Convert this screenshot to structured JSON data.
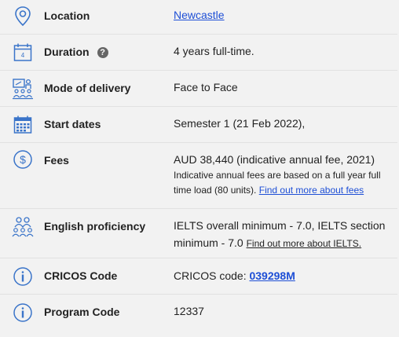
{
  "colors": {
    "icon": "#3a74c9",
    "link": "#1e4fd6",
    "background": "#f2f2f2",
    "divider": "#e1e1e1"
  },
  "rows": {
    "location": {
      "icon": "location-pin-icon",
      "label": "Location",
      "value_link": "Newcastle"
    },
    "duration": {
      "icon": "calendar-day-icon",
      "label": "Duration",
      "help_icon": "question-circle-icon",
      "calendar_day": "4",
      "value": "4 years full-time."
    },
    "delivery": {
      "icon": "classroom-icon",
      "label": "Mode of delivery",
      "value": "Face to Face"
    },
    "start_dates": {
      "icon": "calendar-grid-icon",
      "label": "Start dates",
      "value": "Semester 1 (21 Feb 2022),"
    },
    "fees": {
      "icon": "dollar-circle-icon",
      "label": "Fees",
      "value": "AUD 38,440 (indicative annual fee, 2021)",
      "note": "Indicative annual fees are based on a full year full time load (80 units).",
      "link": "Find out more about fees"
    },
    "english": {
      "icon": "people-group-icon",
      "label": "English proficiency",
      "value": "IELTS overall minimum - 7.0, IELTS section minimum - 7.0",
      "link": "Find out more about IELTS."
    },
    "cricos": {
      "icon": "info-circle-icon",
      "label": "CRICOS Code",
      "value_prefix": "CRICOS code:",
      "value_link": "039298M"
    },
    "program": {
      "icon": "info-circle-icon",
      "label": "Program Code",
      "value": "12337"
    }
  }
}
